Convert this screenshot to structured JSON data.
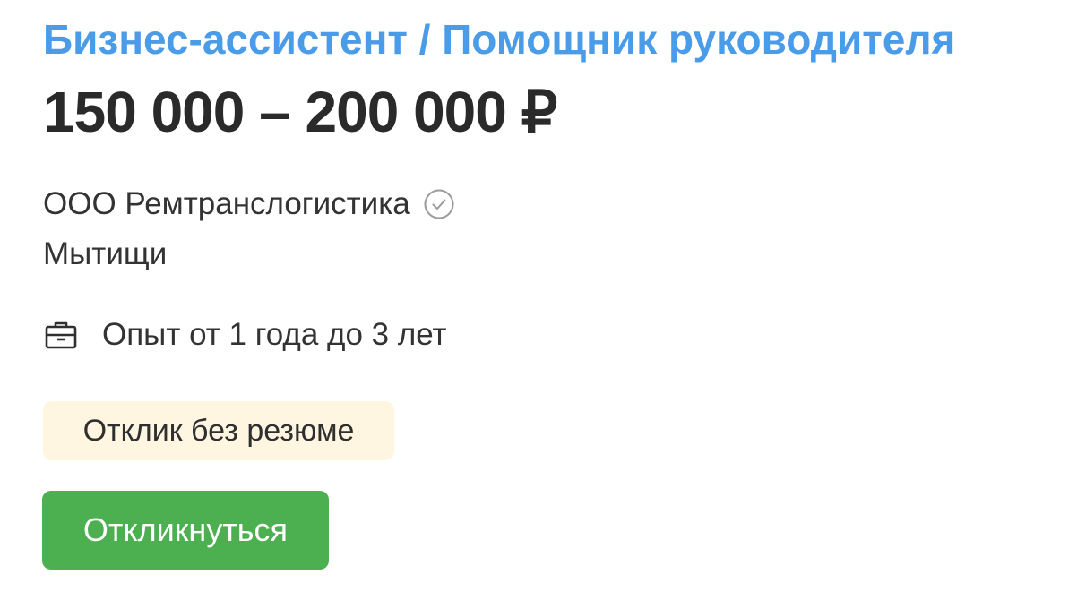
{
  "vacancy": {
    "title": "Бизнес-ассистент / Помощник руководителя",
    "salary": "150 000 – 200 000 ₽",
    "company": "ООО Ремтранслогистика",
    "company_verified_icon": "check-circle-icon",
    "city": "Мытищи",
    "experience_icon": "briefcase-icon",
    "experience": "Опыт от 1 года до 3 лет",
    "badge": "Отклик без резюме",
    "apply_label": "Откликнуться"
  },
  "colors": {
    "title": "#4a9ce8",
    "text": "#333333",
    "badge_bg": "#fff6e2",
    "button_bg": "#4caf50",
    "button_text": "#ffffff"
  }
}
